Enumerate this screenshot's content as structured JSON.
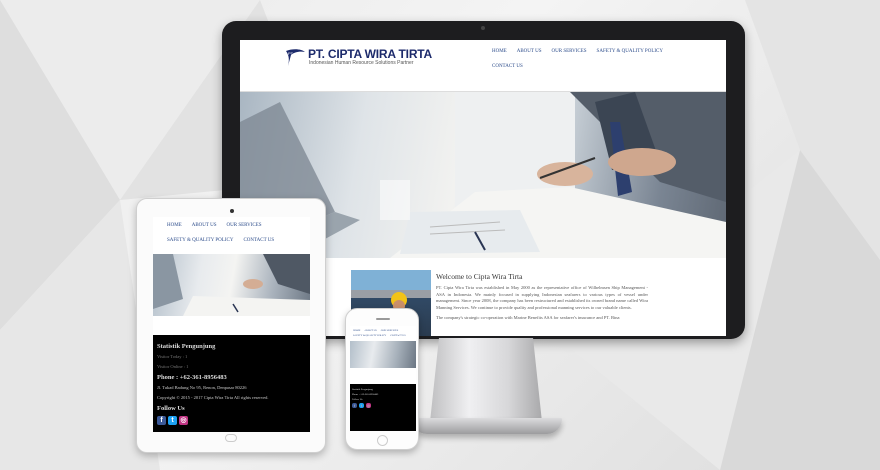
{
  "desktop": {
    "logo": {
      "name": "PT. CIPTA WIRA TIRTA",
      "tagline": "Indonesian Human Resource Solutions Partner",
      "mark_text": "PT"
    },
    "nav": [
      "HOME",
      "ABOUT US",
      "OUR SERVICES",
      "SAFETY & QUALITY POLICY",
      "CONTACT US"
    ],
    "welcome_title": "Welcome to Cipta Wira Tirta",
    "paragraph1": "PT. Cipta Wira Tirta was established in May 2000 as the representative office of Wilhelmsen Ship Management - ASA in Indonesia. We mainly focused in supplying Indonesian seafarers to various types of vessel under management. Since year 2008, the company has been restructured and established its owned brand name called Wira Manning Services. We continue to provide quality and professional manning services to our valuable clients.",
    "paragraph2": "The company's strategic co-operation with Marine Benefits ASA for seafarer's insurance and PT. Bina"
  },
  "tablet": {
    "nav": [
      "HOME",
      "ABOUT US",
      "OUR SERVICES",
      "SAFETY & QUALITY POLICY",
      "CONTACT US"
    ],
    "stats_title": "Statistik Pengunjung",
    "visitors_today": "Visitor Today : 1",
    "visitors_online": "Visitor Online : 1",
    "phone": "Phone : +62-361-8956483",
    "address": "Jl. Tukad Badung No 95, Renon, Denpasar 80226",
    "copyright": "Copyright © 2015 - 2017 Cipta Wira Tirta All rights reserved.",
    "follow": "Follow Us"
  },
  "phone_device": {
    "nav": [
      "HOME",
      "ABOUT US",
      "OUR SERVICES",
      "SAFETY & QUALITY POLICY",
      "CONTACT US"
    ],
    "stats_title": "Statistik Pengunjung",
    "phone": "Phone : +62-361-8956483",
    "follow": "Follow Us"
  },
  "colors": {
    "brand": "#1c2a6b",
    "nav_link": "#2b4b8a",
    "footer_bg": "#000000",
    "facebook": "#3b5998",
    "twitter": "#1da1f2",
    "instagram": "#c13584"
  }
}
